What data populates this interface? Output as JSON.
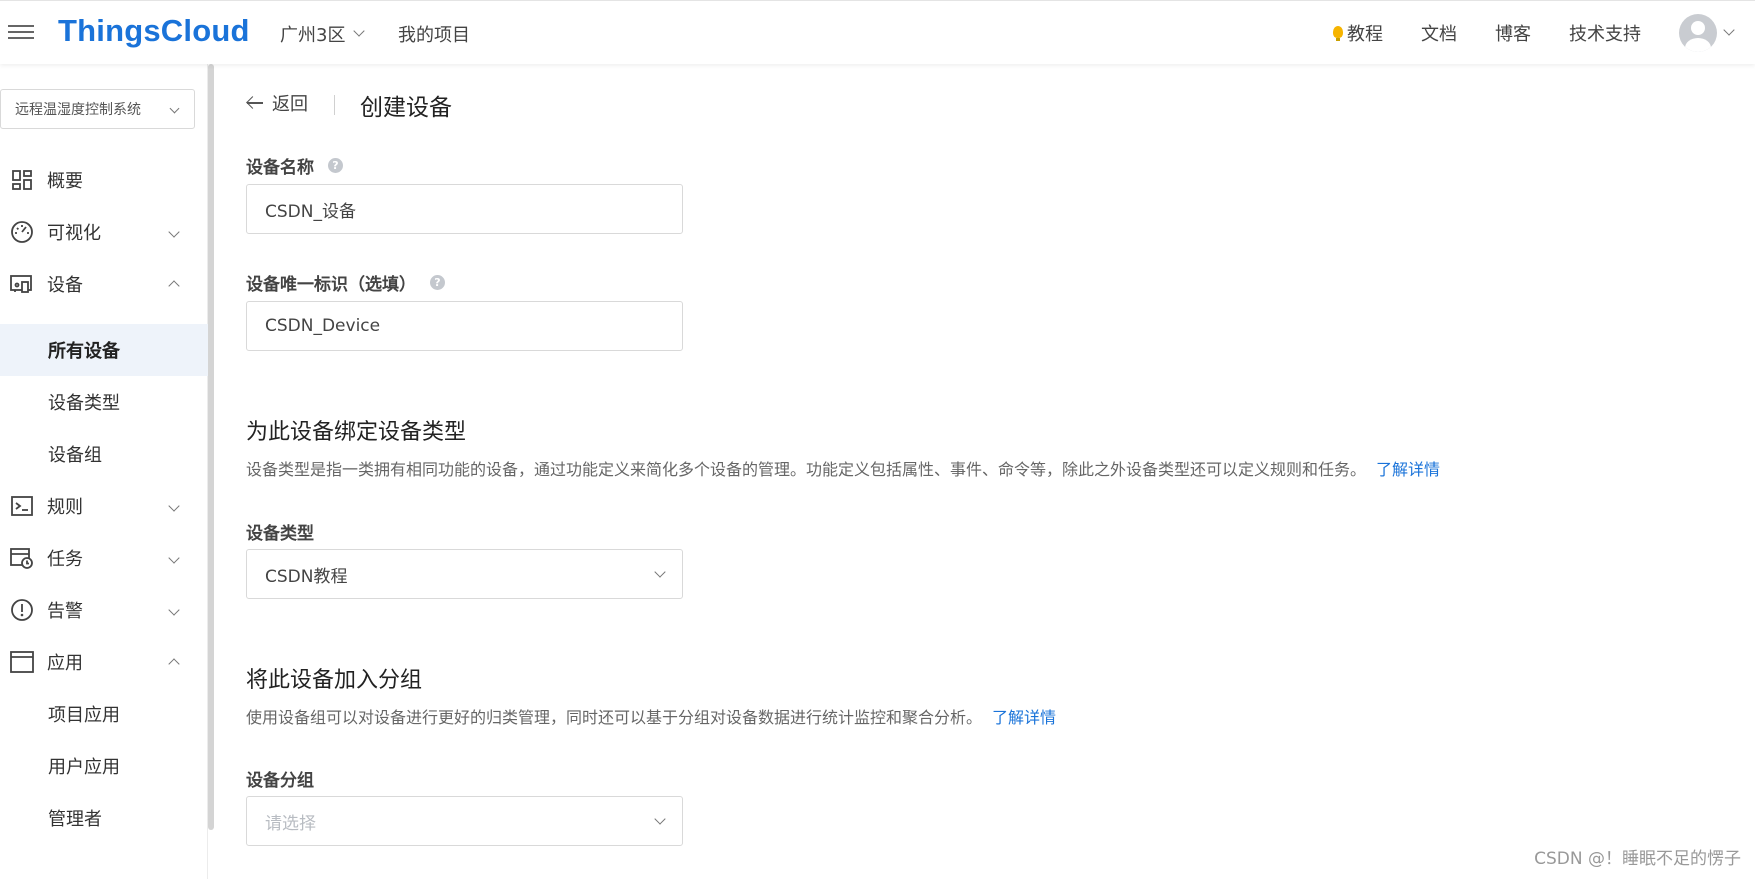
{
  "header": {
    "logo": "ThingsCloud",
    "region": "广州3区",
    "my_projects": "我的项目",
    "links": {
      "tutorial": "教程",
      "docs": "文档",
      "blog": "博客",
      "support": "技术支持"
    }
  },
  "sidebar": {
    "project": "远程温湿度控制系统",
    "items": {
      "overview": "概要",
      "visualization": "可视化",
      "devices": "设备",
      "all_devices": "所有设备",
      "device_types": "设备类型",
      "device_groups": "设备组",
      "rules": "规则",
      "tasks": "任务",
      "alarms": "告警",
      "apps": "应用",
      "project_apps": "项目应用",
      "user_apps": "用户应用",
      "admins": "管理者"
    }
  },
  "main": {
    "back": "返回",
    "title": "创建设备",
    "name_label": "设备名称",
    "name_value": "CSDN_设备",
    "id_label": "设备唯一标识（选填）",
    "id_value": "CSDN_Device",
    "type_section_title": "为此设备绑定设备类型",
    "type_section_desc": "设备类型是指一类拥有相同功能的设备，通过功能定义来简化多个设备的管理。功能定义包括属性、事件、命令等，除此之外设备类型还可以定义规则和任务。",
    "learn_more": "了解详情",
    "type_label": "设备类型",
    "type_value": "CSDN教程",
    "group_section_title": "将此设备加入分组",
    "group_section_desc": "使用设备组可以对设备进行更好的归类管理，同时还可以基于分组对设备数据进行统计监控和聚合分析。",
    "group_label": "设备分组",
    "group_placeholder": "请选择"
  },
  "watermark": "CSDN @！睡眠不足的愣子",
  "colors": {
    "brand": "#1a73d9",
    "active_bg": "#eef3fa",
    "bulb": "#f6b400"
  }
}
